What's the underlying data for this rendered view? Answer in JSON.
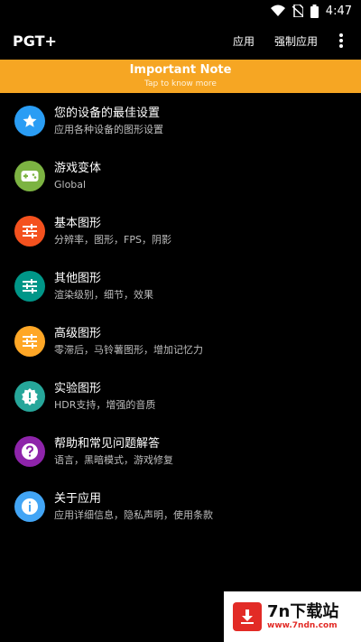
{
  "status_bar": {
    "time": "4:47"
  },
  "app_bar": {
    "title": "PGT+",
    "action_apply": "应用",
    "action_force_apply": "强制应用"
  },
  "banner": {
    "title": "Important Note",
    "subtitle": "Tap to know more",
    "color": "#f6a623"
  },
  "menu": [
    {
      "title": "您的设备的最佳设置",
      "subtitle": "应用各种设备的图形设置",
      "icon": "star-icon",
      "color": "#2a9df4"
    },
    {
      "title": "游戏变体",
      "subtitle": "Global",
      "icon": "gamepad-icon",
      "color": "#7cb342"
    },
    {
      "title": "基本图形",
      "subtitle": "分辨率，图形，FPS，阴影",
      "icon": "sliders-icon",
      "color": "#f4511e"
    },
    {
      "title": "其他图形",
      "subtitle": "渲染级别，细节，效果",
      "icon": "sliders-icon",
      "color": "#009688"
    },
    {
      "title": "高级图形",
      "subtitle": "零滞后，马铃薯图形，增加记忆力",
      "icon": "sliders-icon",
      "color": "#ffa726"
    },
    {
      "title": "实验图形",
      "subtitle": "HDR支持，增强的音质",
      "icon": "alert-badge-icon",
      "color": "#26a69a"
    },
    {
      "title": "帮助和常见问题解答",
      "subtitle": "语言，黑暗模式，游戏修复",
      "icon": "help-icon",
      "color": "#8e24aa"
    },
    {
      "title": "关于应用",
      "subtitle": "应用详细信息，隐私声明，使用条款",
      "icon": "info-icon",
      "color": "#42a5f5"
    }
  ],
  "watermark": {
    "name": "7n下载站",
    "url": "www.7ndn.com"
  }
}
